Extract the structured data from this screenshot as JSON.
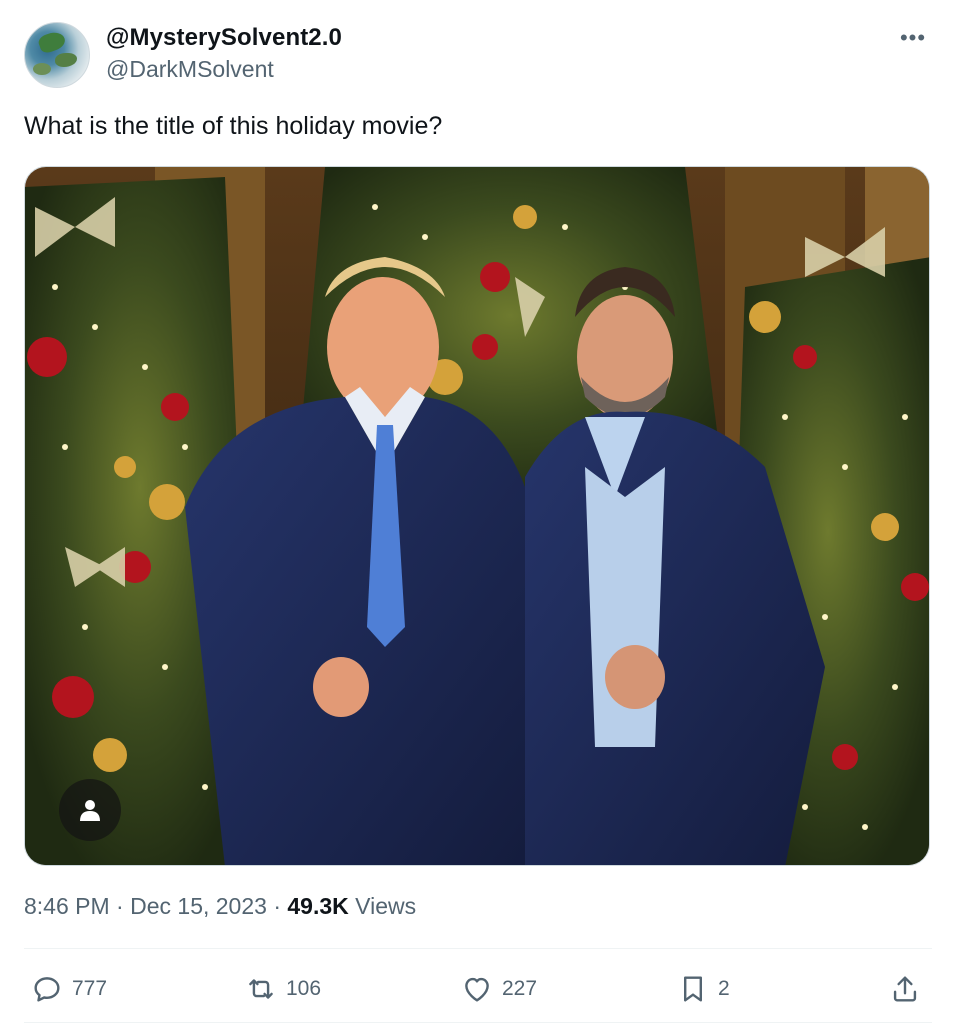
{
  "author": {
    "display_name": "@MysterySolvent2.0",
    "handle": "@DarkMSolvent",
    "avatar_icon": "globe-map-avatar"
  },
  "tweet": {
    "text": "What is the title of this holiday movie?",
    "more_icon": "more-options-icon",
    "more_label": "•••"
  },
  "media": {
    "description_icon": "person-tag-icon"
  },
  "meta": {
    "time": "8:46 PM",
    "sep1": " · ",
    "date": "Dec 15, 2023",
    "sep2": " · ",
    "views_count": "49.3K",
    "views_label": " Views"
  },
  "actions": {
    "replies": "777",
    "reposts": "106",
    "likes": "227",
    "bookmarks": "2"
  },
  "colors": {
    "text_primary": "#0f1419",
    "text_secondary": "#536471",
    "divider": "#eff3f4"
  }
}
